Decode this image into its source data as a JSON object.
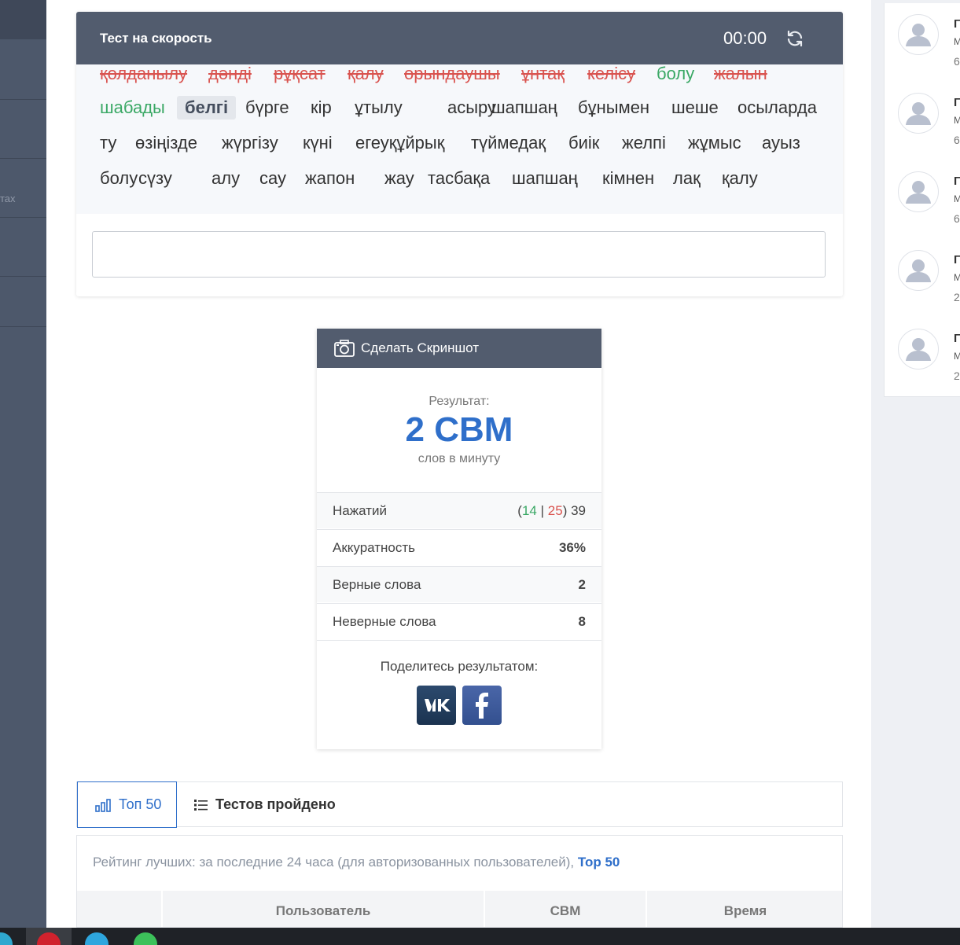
{
  "test": {
    "title": "Тест на скорость",
    "timer": "00:00",
    "words": [
      {
        "text": "қолданылу",
        "status": "wrong"
      },
      {
        "text": "дәнді",
        "status": "wrong"
      },
      {
        "text": "рұқсат",
        "status": "wrong"
      },
      {
        "text": "қалу",
        "status": "wrong"
      },
      {
        "text": "орындаушы",
        "status": "wrong"
      },
      {
        "text": "ұнтақ",
        "status": "wrong"
      },
      {
        "text": "келісу",
        "status": "wrong"
      },
      {
        "text": "болу",
        "status": "right"
      },
      {
        "text": "жалын",
        "status": "wrong"
      },
      {
        "text": "шабады",
        "status": "right"
      },
      {
        "text": "белгі",
        "status": "current"
      },
      {
        "text": "бүрге",
        "status": "pending"
      },
      {
        "text": "кір",
        "status": "pending"
      },
      {
        "text": "ұтылу",
        "status": "pending"
      },
      {
        "text": "асыру",
        "status": "pending"
      },
      {
        "text": "шапшаң",
        "status": "pending"
      },
      {
        "text": "бұнымен",
        "status": "pending"
      },
      {
        "text": "шеше",
        "status": "pending"
      },
      {
        "text": "осыларда",
        "status": "pending"
      },
      {
        "text": "ту",
        "status": "pending"
      },
      {
        "text": "өзіңізде",
        "status": "pending"
      },
      {
        "text": "жүргізу",
        "status": "pending"
      },
      {
        "text": "күні",
        "status": "pending"
      },
      {
        "text": "егеуқұйрық",
        "status": "pending"
      },
      {
        "text": "түймедақ",
        "status": "pending"
      },
      {
        "text": "биік",
        "status": "pending"
      },
      {
        "text": "желпі",
        "status": "pending"
      },
      {
        "text": "жұмыс",
        "status": "pending"
      },
      {
        "text": "ауыз",
        "status": "pending"
      },
      {
        "text": "болу",
        "status": "pending"
      },
      {
        "text": "сүзу",
        "status": "pending"
      },
      {
        "text": "алу",
        "status": "pending"
      },
      {
        "text": "сау",
        "status": "pending"
      },
      {
        "text": "жапон",
        "status": "pending"
      },
      {
        "text": "жау",
        "status": "pending"
      },
      {
        "text": "тасбақа",
        "status": "pending"
      },
      {
        "text": "шапшаң",
        "status": "pending"
      },
      {
        "text": "кімнен",
        "status": "pending"
      },
      {
        "text": "лақ",
        "status": "pending"
      },
      {
        "text": "қалу",
        "status": "pending"
      }
    ],
    "input_value": ""
  },
  "result": {
    "screenshot_label": "Сделать Скриншот",
    "label": "Результат:",
    "value": "2 СВМ",
    "unit": "слов в минуту",
    "keystrokes_label": "Нажатий",
    "keystrokes_correct": "14",
    "keystrokes_wrong": "25",
    "keystrokes_total": "39",
    "accuracy_label": "Аккуратность",
    "accuracy_value": "36%",
    "correct_words_label": "Верные слова",
    "correct_words_value": "2",
    "wrong_words_label": "Неверные слова",
    "wrong_words_value": "8",
    "share_label": "Поделитесь результатом:"
  },
  "tabs": {
    "top50_label": "Топ 50",
    "tests_label": "Тестов пройдено"
  },
  "rating": {
    "text": "Рейтинг лучших: за последние 24 часа (для авторизованных пользователей),",
    "link": "Top 50",
    "columns": [
      "",
      "Пользователь",
      "СВМ",
      "Время"
    ]
  },
  "right_panel": {
    "cards": [
      {
        "name": "Г",
        "sub": "М",
        "num": "6"
      },
      {
        "name": "Г",
        "sub": "М",
        "num": "6"
      },
      {
        "name": "Г",
        "sub": "М",
        "num": "6"
      },
      {
        "name": "Г",
        "sub": "М",
        "num": "2"
      },
      {
        "name": "Г",
        "sub": "М",
        "num": "2"
      }
    ]
  },
  "sidebar": {
    "fragment_text": "тах"
  },
  "colors": {
    "header": "#525c6e",
    "accent": "#2f6fca",
    "correct": "#3aa865",
    "wrong": "#d9534f"
  }
}
